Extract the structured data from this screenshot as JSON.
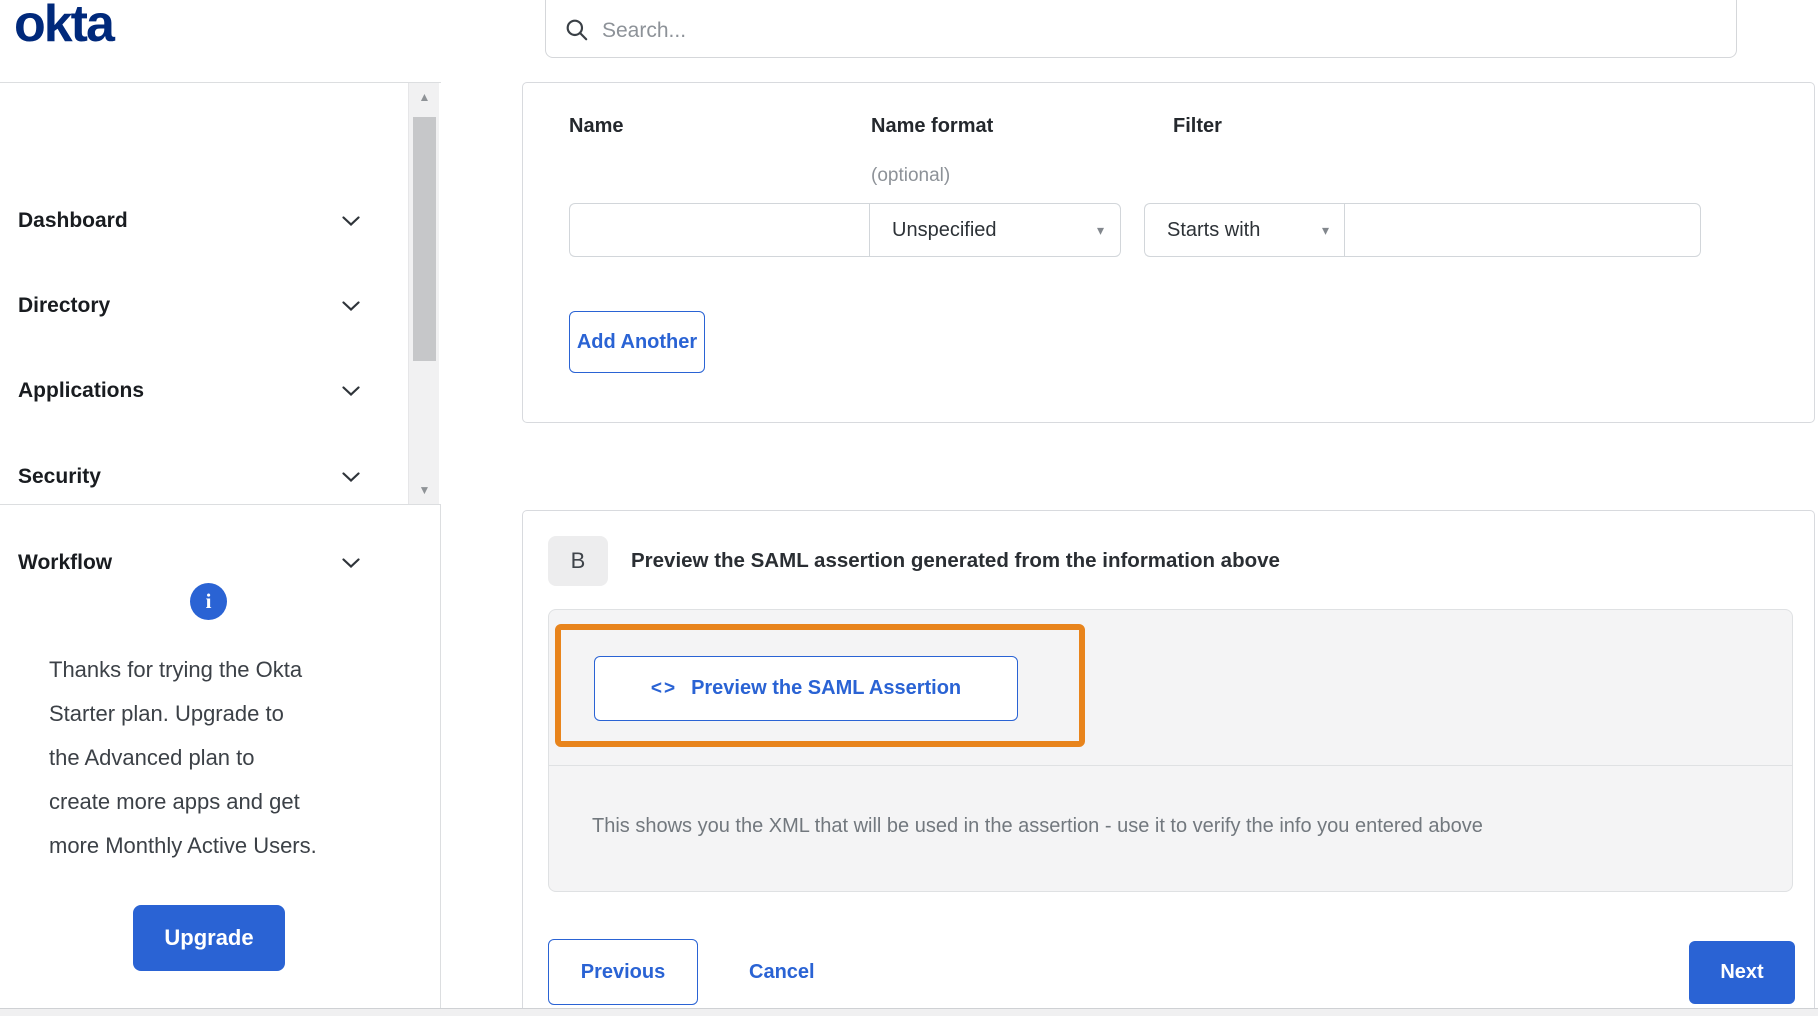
{
  "brand": {
    "logo_text": "okta"
  },
  "header": {
    "search_placeholder": "Search...",
    "search_value": ""
  },
  "sidebar": {
    "items": [
      {
        "label": "Dashboard"
      },
      {
        "label": "Directory"
      },
      {
        "label": "Applications"
      },
      {
        "label": "Security"
      },
      {
        "label": "Workflow"
      }
    ],
    "upsell": {
      "lines": [
        "Thanks for trying the Okta",
        "Starter plan. Upgrade to",
        "the Advanced plan to",
        "create more apps and get",
        "more Monthly Active Users."
      ],
      "button_label": "Upgrade"
    }
  },
  "attribute_form": {
    "columns": {
      "name": "Name",
      "name_format": "Name format",
      "name_format_note": "(optional)",
      "filter": "Filter"
    },
    "fields": {
      "name_value": "",
      "name_format_selected": "Unspecified",
      "filter_operator_selected": "Starts with",
      "filter_value": ""
    },
    "add_another_label": "Add Another"
  },
  "preview_section": {
    "badge": "B",
    "heading": "Preview the SAML assertion generated from the information above",
    "button": {
      "icon": "<>",
      "label": "Preview the SAML Assertion"
    },
    "help_text": "This shows you the XML that will be used in the assertion - use it to verify the info you entered above"
  },
  "wizard_footer": {
    "previous": "Previous",
    "cancel": "Cancel",
    "next": "Next"
  },
  "icons": {
    "dropdown_arrow_glyph": "▾",
    "scroll_up_glyph": "▲",
    "scroll_down_glyph": "▼",
    "info_glyph": "i",
    "badge_glyph": "B"
  },
  "colors": {
    "accent_blue": "#2a63d4",
    "logo_navy": "#00297b",
    "annotation_orange": "#e8841c",
    "panel_gray": "#f4f4f5"
  }
}
